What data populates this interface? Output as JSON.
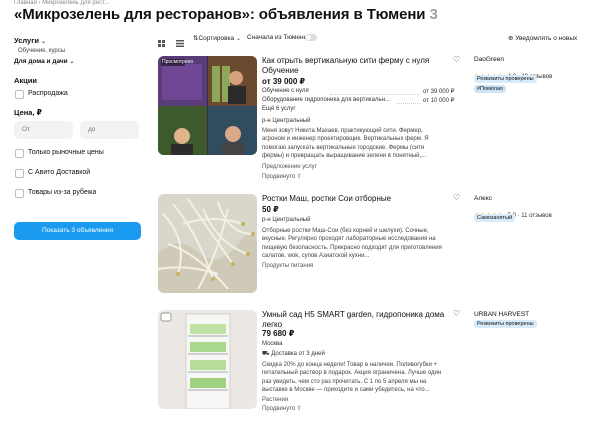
{
  "breadcrumb": "Главная › Микрозелень для рест...",
  "page": {
    "title": "«Микрозелень для ресторанов»: объявления в Тюмени",
    "count": "3"
  },
  "sidebar": {
    "services_label": "Услуги",
    "services_sub": "Обучение, курсы",
    "home_label": "Для дома и дачи",
    "promo_label": "Акции",
    "sale_label": "Распродажа",
    "price_label": "Цена, ₽",
    "price_from": "От",
    "price_to": "до",
    "filters": [
      "Только рыночные цены",
      "С Авито Доставкой",
      "Товары из-за рубежа"
    ],
    "show_button": "Показать 3 объявления"
  },
  "toolbar": {
    "sort_label": "Сортировка",
    "tyumen_label": "Сначала из Тюмени",
    "notify_label": "Уведомлять о новых"
  },
  "listings": [
    {
      "title": "Как отрыть вертикальную сити ферму с нуля Обучение",
      "price": "от 39 000 ₽",
      "options": [
        {
          "name": "Обучение с нуля",
          "price": "от 39 000 ₽"
        },
        {
          "name": "Оборудование гидропоника для вертикальн...",
          "price": "от 10 000 ₽"
        }
      ],
      "more": "Ещё 6 услуг",
      "location": "р-н Центральный",
      "desc": "Меня зовут Никита Махаев, практикующий сити. Фермер, агроном и инженер проектировщик. Вертикальных ферм. Я помогаю запускать вертикальные городские. Фермы (сити фермы) и превращать выращивание зелени в понятный,...",
      "category": "Предложение услуг",
      "promoted": "Продвинуто",
      "seller": "DaoGreen",
      "rating": "4,9 · 49 отзывов",
      "badges": [
        "Реквизиты проверены",
        "#Помогаю"
      ],
      "image_label": "Просмотрено"
    },
    {
      "title": "Ростки Маш, ростки Сои отборные",
      "price": "50 ₽",
      "location": "р-н Центральный",
      "desc": "Отборные ростки Маш-Сои (без корней и шелухи). Сочные, вкусные. Регулярно проходят лабораторные исследования на пищевую безопасность. Прекрасно подходят для приготовления салатов, wok, супов Азиатской кухни...",
      "category": "Продукты питания",
      "seller": "Алекс",
      "rating": "5,0 · 11 отзывов",
      "badges": [
        "Самозанятый"
      ]
    },
    {
      "title": "Умный сад H5 SMART garden, гидропоника дома легко",
      "price": "79 680 ₽",
      "location": "Москва",
      "delivery": "Доставка от 3 дней",
      "desc": "Скидка 20% до конца недели! Товар в наличии. Поливогубки + питательный раствор в подарок. Акция ограничена. Лучше один раз увидеть, чем сто раз прочитать. С 1 по 5 апреля мы на выставке в Москве — приходите и сами убедитесь, на что...",
      "category": "Растения",
      "promoted": "Продвинуто",
      "seller": "URBAN HARVEST",
      "badges": [
        "Реквизиты проверены"
      ]
    }
  ],
  "colors": {
    "accent": "#1b9bf0",
    "star": "#f5a623",
    "badge": "#d8ebfa"
  },
  "icons": [
    "grid-view-icon",
    "list-view-icon",
    "sort-icon",
    "notify-icon",
    "heart-icon",
    "checkbox-icon",
    "chevron-down-icon",
    "delivery-icon",
    "promoted-arrow-icon"
  ]
}
